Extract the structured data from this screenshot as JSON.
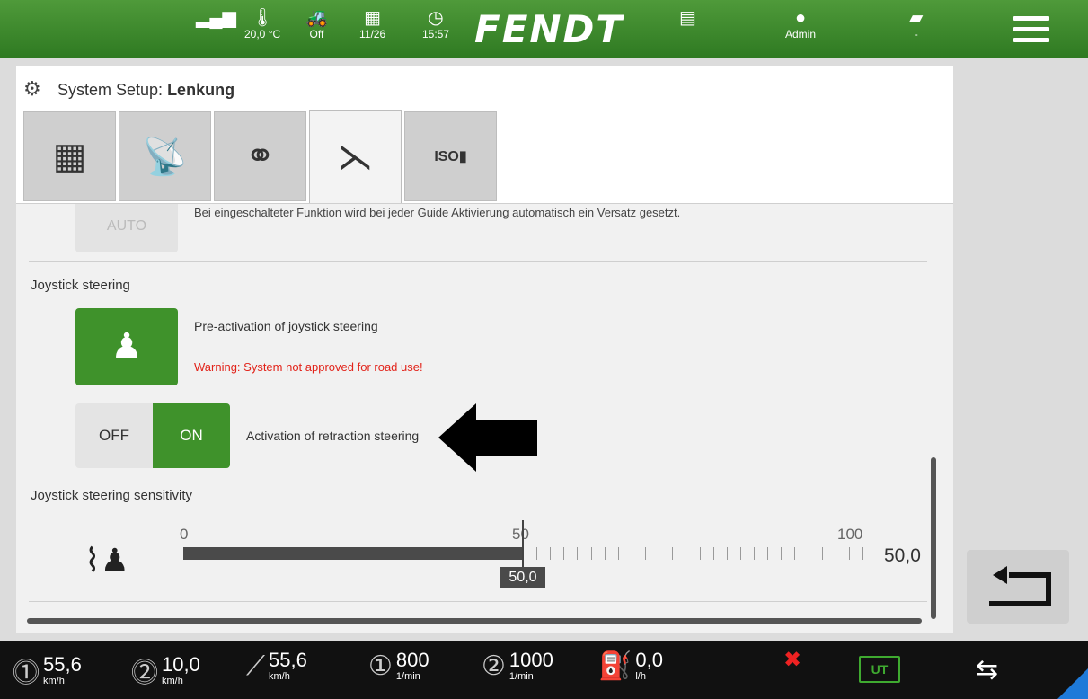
{
  "topbar": {
    "temperature": "20,0 °C",
    "pto_status": "Off",
    "date": "11/26",
    "time": "15:57",
    "brand": "FENDT",
    "user": "Admin",
    "field": "-",
    "icons": [
      "signal-icon",
      "thermometer-icon",
      "tractor-icon",
      "calendar-icon",
      "clock-icon",
      "document-icon",
      "user-icon",
      "field-icon",
      "menu-icon"
    ]
  },
  "panel": {
    "title_prefix": "System Setup: ",
    "title_bold": "Lenkung",
    "tabs": [
      {
        "name": "tab-schedule",
        "icon": "calendar-clock-icon"
      },
      {
        "name": "tab-gps",
        "icon": "satellite-icon"
      },
      {
        "name": "tab-network",
        "icon": "network-icon"
      },
      {
        "name": "tab-steering",
        "icon": "steering-icon",
        "active": true
      },
      {
        "name": "tab-isobus",
        "label": "ISOBUS"
      }
    ]
  },
  "content": {
    "auto_label": "AUTO",
    "cut_text": "Bei eingeschalteter Funktion wird bei jeder Guide Aktivierung automatisch ein Versatz gesetzt.",
    "joystick_section": "Joystick steering",
    "preactivation_label": "Pre-activation of joystick steering",
    "warning": "Warning: System not approved for road use!",
    "toggle_off": "OFF",
    "toggle_on": "ON",
    "toggle_state": "ON",
    "retraction_label": "Activation of retraction steering",
    "sensitivity_section": "Joystick steering sensitivity",
    "slider": {
      "min_label": "0",
      "mid_label": "50",
      "max_label": "100",
      "value": 50,
      "value_label": "50,0",
      "value_right": "50,0"
    }
  },
  "bottombar": {
    "speed1": {
      "value": "55,6",
      "unit": "km/h"
    },
    "speed2": {
      "value": "10,0",
      "unit": "km/h"
    },
    "speed3": {
      "value": "55,6",
      "unit": "km/h"
    },
    "pto1": {
      "value": "800",
      "unit": "1/min"
    },
    "pto2": {
      "value": "1000",
      "unit": "1/min"
    },
    "fuel": {
      "value": "0,0",
      "unit": "l/h"
    },
    "ut_label": "UT"
  },
  "colors": {
    "green": "#3f922b",
    "warning": "#e2231a",
    "blue_corner": "#1e7ad9"
  }
}
